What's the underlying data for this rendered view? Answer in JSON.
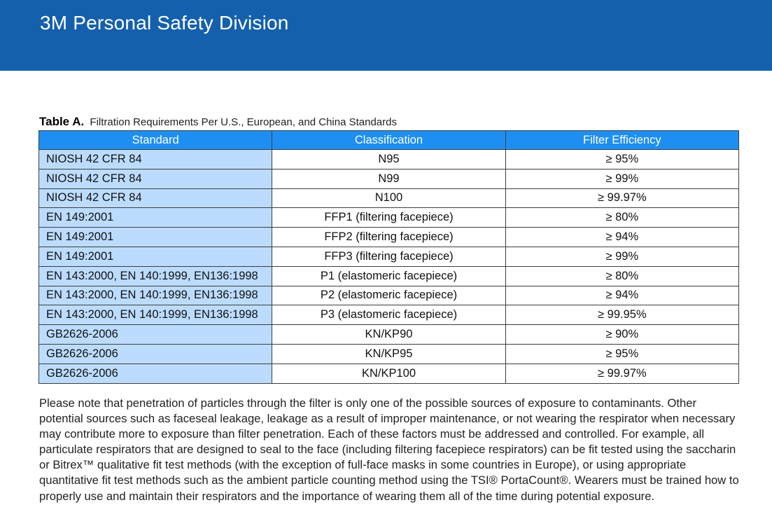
{
  "header": {
    "title": "3M Personal Safety Division",
    "band_color": "#1460ad"
  },
  "table": {
    "caption_label": "Table A.",
    "caption_text": "Filtration Requirements Per U.S., European, and China Standards",
    "header_color": "#1e8ff2",
    "first_column_color": "#bcdcff",
    "columns": [
      "Standard",
      "Classification",
      "Filter Efficiency"
    ],
    "rows": [
      {
        "standard": "NIOSH 42 CFR 84",
        "classification": "N95",
        "efficiency": "≥ 95%"
      },
      {
        "standard": "NIOSH 42 CFR 84",
        "classification": "N99",
        "efficiency": "≥ 99%"
      },
      {
        "standard": "NIOSH 42 CFR 84",
        "classification": "N100",
        "efficiency": "≥ 99.97%"
      },
      {
        "standard": "EN 149:2001",
        "classification": "FFP1 (filtering facepiece)",
        "efficiency": "≥ 80%"
      },
      {
        "standard": "EN 149:2001",
        "classification": "FFP2 (filtering facepiece)",
        "efficiency": "≥ 94%"
      },
      {
        "standard": "EN 149:2001",
        "classification": "FFP3 (filtering facepiece)",
        "efficiency": "≥ 99%"
      },
      {
        "standard": "EN 143:2000, EN 140:1999, EN136:1998",
        "classification": "P1 (elastomeric facepiece)",
        "efficiency": "≥ 80%"
      },
      {
        "standard": "EN 143:2000, EN 140:1999, EN136:1998",
        "classification": "P2 (elastomeric facepiece)",
        "efficiency": "≥ 94%"
      },
      {
        "standard": "EN 143:2000, EN 140:1999, EN136:1998",
        "classification": "P3 (elastomeric facepiece)",
        "efficiency": "≥ 99.95%"
      },
      {
        "standard": "GB2626-2006",
        "classification": "KN/KP90",
        "efficiency": "≥ 90%"
      },
      {
        "standard": "GB2626-2006",
        "classification": "KN/KP95",
        "efficiency": "≥ 95%"
      },
      {
        "standard": "GB2626-2006",
        "classification": "KN/KP100",
        "efficiency": "≥ 99.97%"
      }
    ]
  },
  "note": {
    "text": "Please note that penetration of particles through the filter is only one of the possible sources of exposure to contaminants. Other potential sources such as faceseal leakage, leakage as a result of improper maintenance, or not wearing the respirator when necessary may contribute more to exposure than filter penetration. Each of these factors must be addressed and controlled. For example, all particulate respirators that are designed to seal to the face (including filtering facepiece respirators) can be fit tested using the saccharin or Bitrex™ qualitative fit test methods (with the exception of full-face masks in some countries in Europe), or using appropriate quantitative fit test methods such as the ambient particle counting method using the TSI® PortaCount®. Wearers must be trained how to properly use and maintain their respirators and the importance of wearing them all of the time during potential exposure."
  }
}
